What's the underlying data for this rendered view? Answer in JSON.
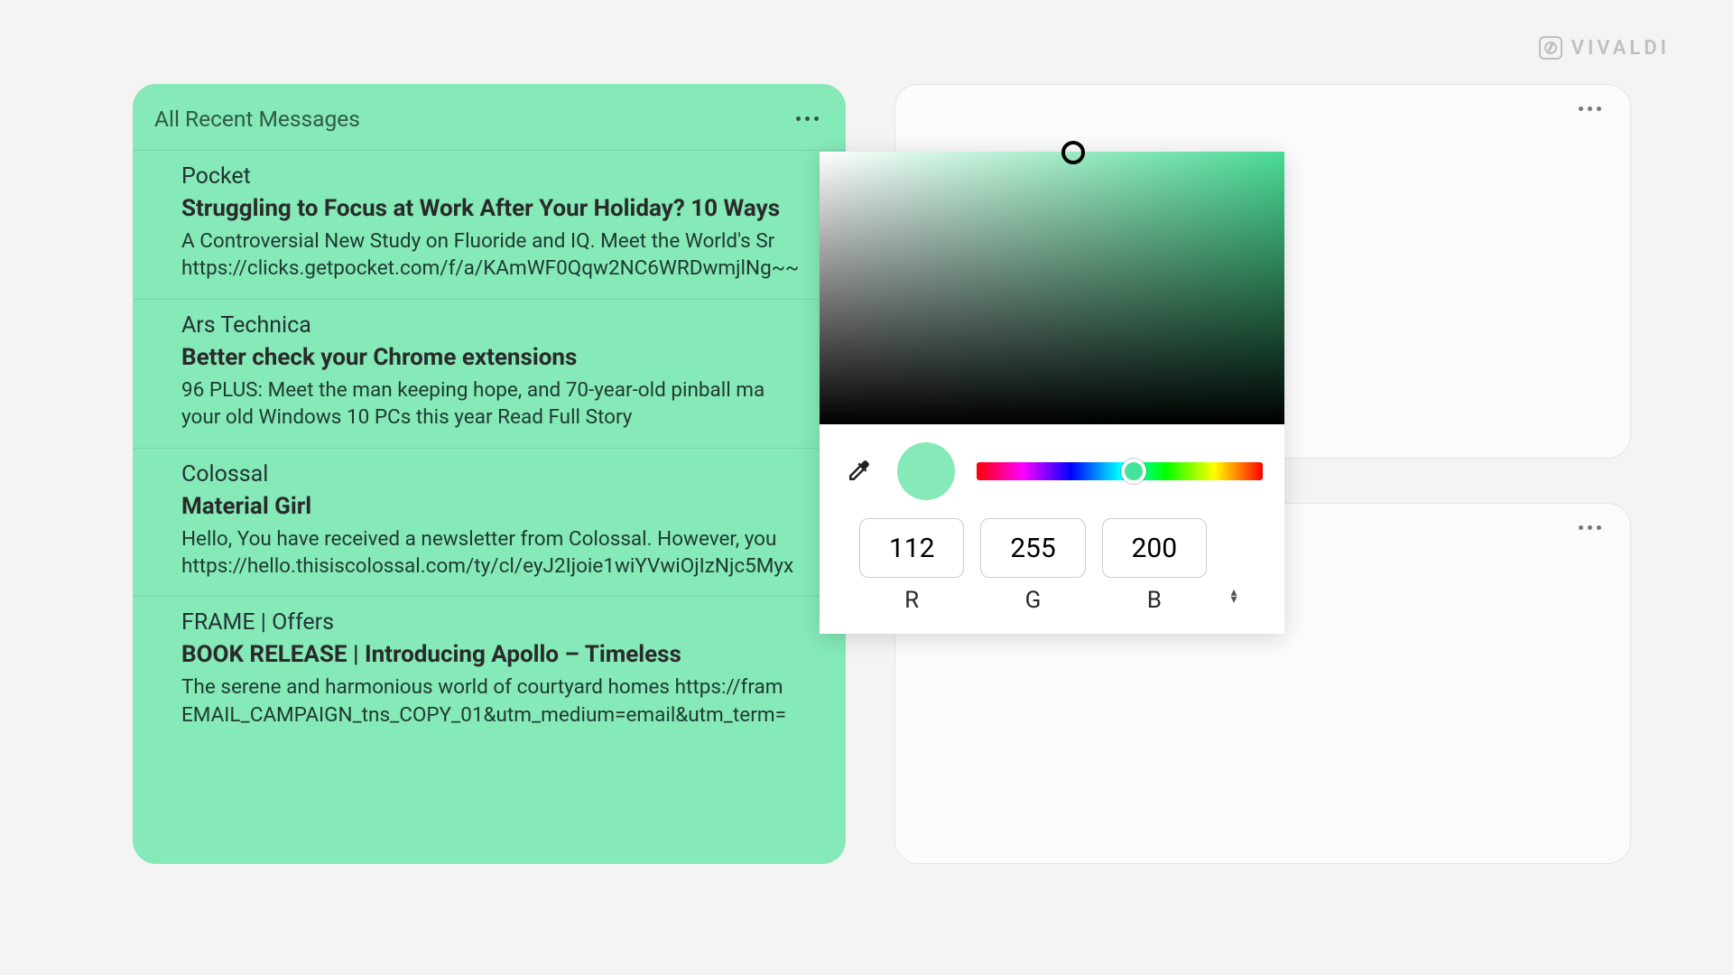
{
  "brand": "VIVALDI",
  "panel": {
    "title": "All Recent Messages",
    "messages": [
      {
        "sender": "Pocket",
        "title": "Struggling to Focus at Work After Your Holiday? 10 Ways",
        "body": "A Controversial New Study on Fluoride and IQ. Meet the World's Sr\nhttps://clicks.getpocket.com/f/a/KAmWF0Qqw2NC6WRDwmjlNg~~"
      },
      {
        "sender": "Ars Technica",
        "title": "Better check your Chrome extensions",
        "body": "96 PLUS: Meet the man keeping hope, and 70-year-old pinball ma\nyour old Windows 10 PCs this year Read Full Story"
      },
      {
        "sender": "Colossal",
        "title": "Material Girl",
        "body": "Hello, You have received a newsletter from Colossal. However, you\nhttps://hello.thisiscolossal.com/ty/cl/eyJ2Ijoie1wiYVwiOjIzNjc5Myx"
      },
      {
        "sender": "FRAME | Offers",
        "title": "BOOK RELEASE | Introducing Apollo – Timeless",
        "body": "The serene and harmonious world of courtyard homes https://fram\nEMAIL_CAMPAIGN_tns_COPY_01&utm_medium=email&utm_term="
      }
    ]
  },
  "picker": {
    "swatch_color": "#85e9b8",
    "r": "112",
    "g": "255",
    "b": "200",
    "r_label": "R",
    "g_label": "G",
    "b_label": "B"
  }
}
